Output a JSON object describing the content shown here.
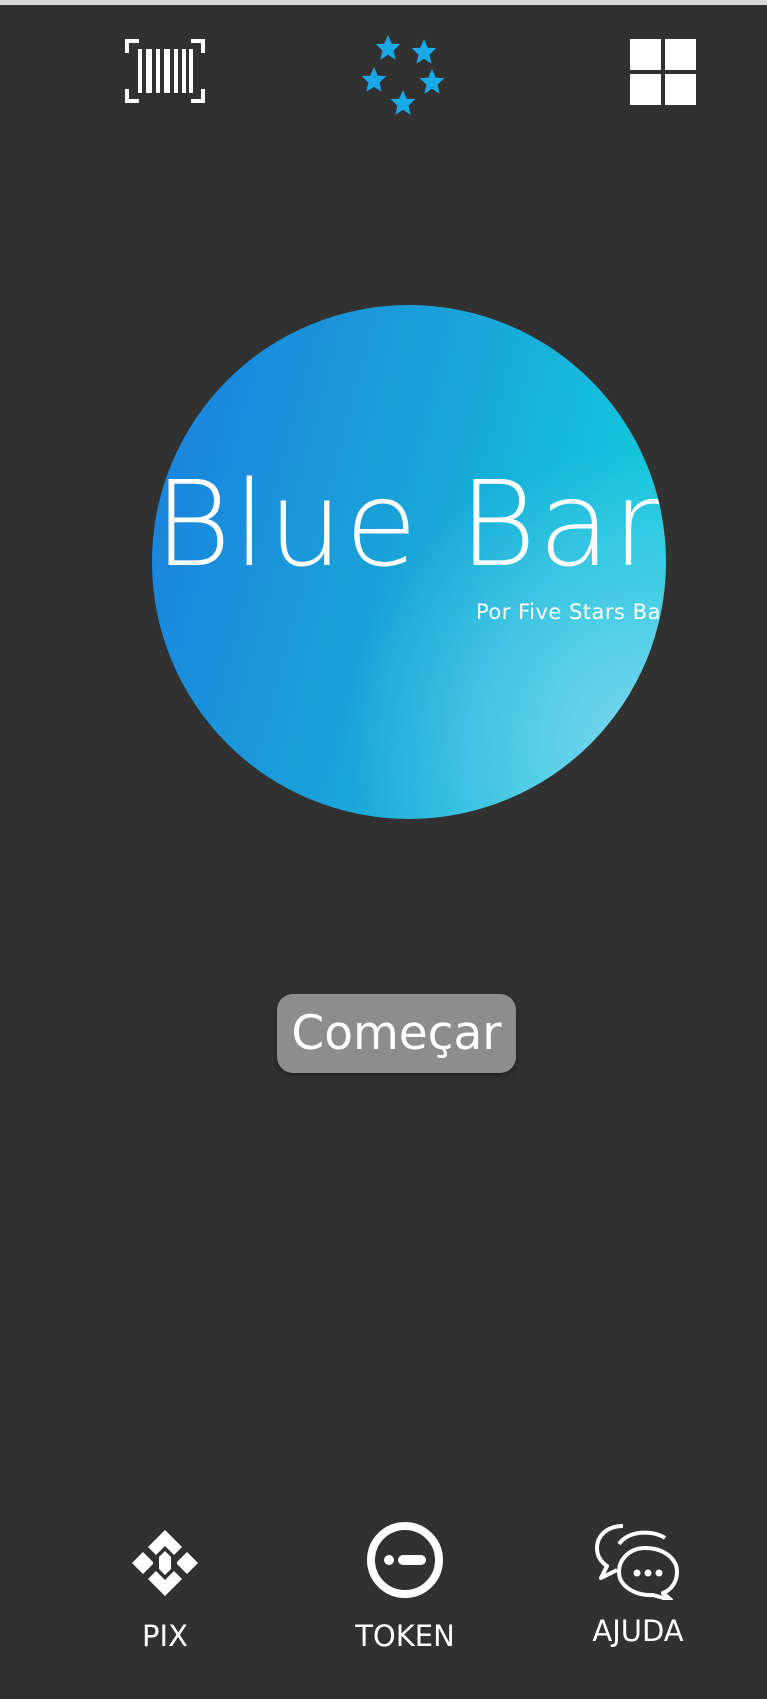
{
  "header": {
    "icons": [
      "barcode-scan-icon",
      "stars-logo-icon",
      "grid-menu-icon"
    ]
  },
  "logo": {
    "title": "Blue Bank",
    "subtitle": "Por Five Stars Bank"
  },
  "main": {
    "start_label": "Começar"
  },
  "bottom_nav": {
    "pix_label": "PIX",
    "token_label": "TOKEN",
    "help_label": "AJUDA",
    "icons": [
      "pix-icon",
      "token-icon",
      "chat-help-icon"
    ]
  },
  "colors": {
    "background": "#313131",
    "accent_star": "#18a9e6",
    "button": "#8d8d8d",
    "logo_gradient_start": "#1a7fde",
    "logo_gradient_end": "#12cee0"
  }
}
